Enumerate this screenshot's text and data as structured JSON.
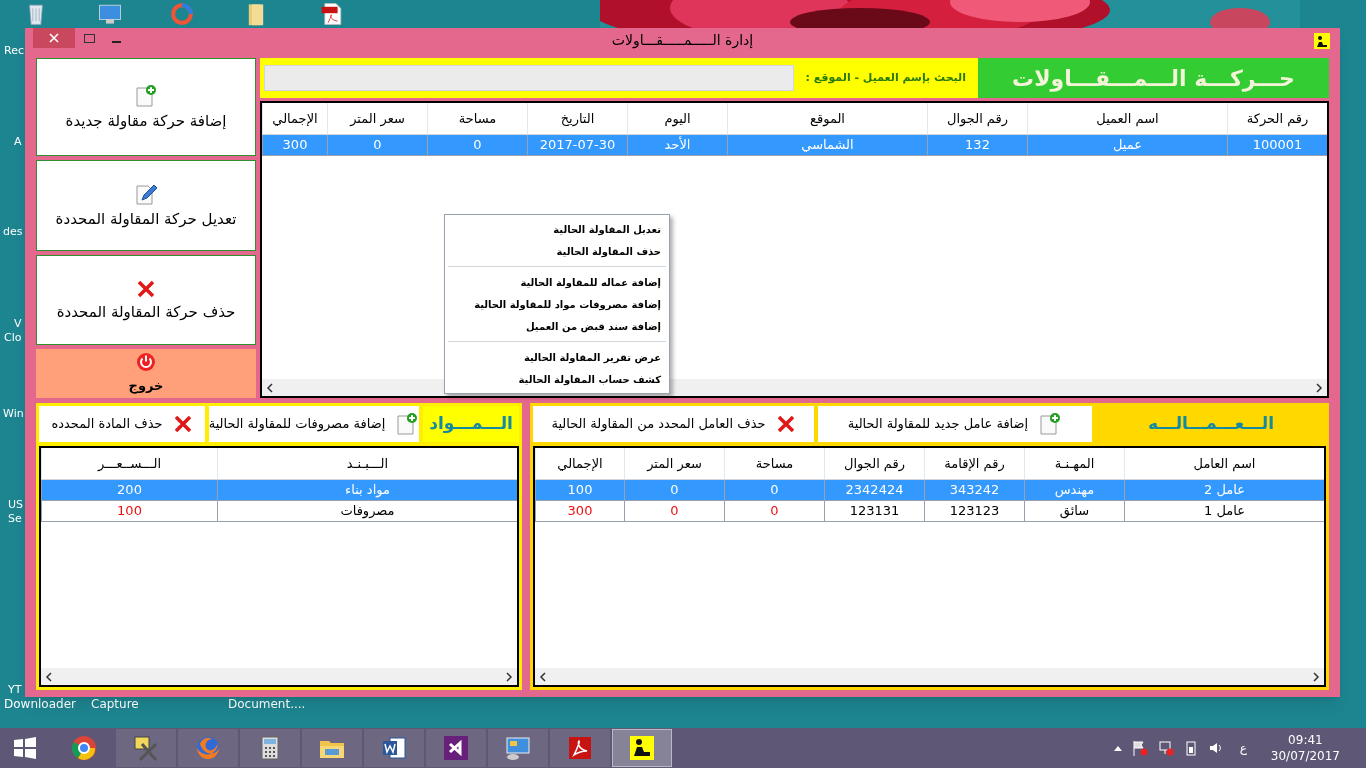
{
  "desktop": {
    "edge_labels": [
      "Rec",
      "A",
      "des",
      "V",
      "Clo",
      "Win",
      "US",
      "Se",
      "YT"
    ],
    "icons": [
      {
        "label": "Document...."
      },
      {
        "label": "Capture"
      },
      {
        "label": "Downloader"
      }
    ]
  },
  "window": {
    "title": "إدارة الـــــمـــــقـــاولات"
  },
  "actions": [
    {
      "kind": "add",
      "label": "إضافة حركة مقاولة جديدة"
    },
    {
      "kind": "edit",
      "label": "تعديل حركة المقاولة المحددة"
    },
    {
      "kind": "delete",
      "label": "حذف حركة المقاولة المحددة"
    },
    {
      "kind": "exit",
      "label": "خروج"
    }
  ],
  "header": {
    "title": "حـــركـــة الـــمـــقـــاولات",
    "search_label": "البحث بإسم العميل - الموقع :"
  },
  "contracts": {
    "columns": [
      {
        "label": "رقم الحركة"
      },
      {
        "label": "اسم العميل"
      },
      {
        "label": "رقم الجوال"
      },
      {
        "label": "الموقع"
      },
      {
        "label": "اليوم"
      },
      {
        "label": "التاريخ"
      },
      {
        "label": "مساحة"
      },
      {
        "label": "سعر المتر"
      },
      {
        "label": "الإجمالي"
      }
    ],
    "rows": [
      {
        "selected": true,
        "cells": [
          "100001",
          "عميل",
          "132",
          "الشماسي",
          "الأحد",
          "2017-07-30",
          "0",
          "0",
          "300"
        ]
      }
    ]
  },
  "context_menu": {
    "groups": [
      [
        "تعديل المقاولة الحالية",
        "حذف المقاولة الحالية"
      ],
      [
        "إضافة عماله للمقاولة الحالية",
        "إضافة مصروفات مواد للمقاولة الحالية",
        "إضافة سند قبض من العميل"
      ],
      [
        "عرض تقرير المقاولة الحالية",
        "كشف حساب المقاولة الحالية"
      ]
    ]
  },
  "materials": {
    "title": "الـــمـــواد",
    "buttons": [
      {
        "kind": "add",
        "label": "إضافة مصروفات للمقاولة الحالية"
      },
      {
        "kind": "delete",
        "label": "حذف المادة المحدده"
      }
    ],
    "columns": [
      {
        "label": "الـــبـنـد",
        "kind": "text"
      },
      {
        "label": "الـــســعـــر",
        "kind": "number"
      }
    ],
    "rows": [
      {
        "selected": true,
        "flagged": false,
        "cells": [
          "مواد بناء",
          "200"
        ]
      },
      {
        "selected": false,
        "flagged": true,
        "cells": [
          "مصروفات",
          "100"
        ]
      }
    ]
  },
  "workers": {
    "title": "الـــعـــمـــالـــه",
    "buttons": [
      {
        "kind": "add",
        "label": "إضافة عامل جديد للمقاولة الحالية"
      },
      {
        "kind": "delete",
        "label": "حذف العامل المحدد من المقاولة الحالية"
      }
    ],
    "columns": [
      {
        "label": "اسم العامل",
        "kind": "text"
      },
      {
        "label": "المهـنـة",
        "kind": "text"
      },
      {
        "label": "رقم الإقامة",
        "kind": "text"
      },
      {
        "label": "رقم الجوال",
        "kind": "text"
      },
      {
        "label": "مساحة",
        "kind": "number"
      },
      {
        "label": "سعر المتر",
        "kind": "number"
      },
      {
        "label": "الإجمالي",
        "kind": "number"
      }
    ],
    "rows": [
      {
        "selected": true,
        "flagged": false,
        "cells": [
          "عامل 2",
          "مهندس",
          "343242",
          "2342424",
          "0",
          "0",
          "100"
        ]
      },
      {
        "selected": false,
        "flagged": true,
        "cells": [
          "عامل 1",
          "سائق",
          "123123",
          "123131",
          "0",
          "0",
          "300"
        ]
      }
    ]
  },
  "taskbar": {
    "apps": [
      {
        "kind": "browser",
        "selected": false
      },
      {
        "kind": "tools",
        "selected": false
      },
      {
        "kind": "globe",
        "selected": false
      },
      {
        "kind": "calculator",
        "selected": false
      },
      {
        "kind": "folder",
        "selected": false
      },
      {
        "kind": "word",
        "selected": false
      },
      {
        "kind": "ribbon",
        "selected": false
      },
      {
        "kind": "monitor",
        "selected": false
      },
      {
        "kind": "pdf",
        "selected": false
      },
      {
        "kind": "worker",
        "selected": true
      }
    ],
    "tray": {
      "language": "ع",
      "time": "09:41",
      "date": "30/07/2017"
    }
  }
}
